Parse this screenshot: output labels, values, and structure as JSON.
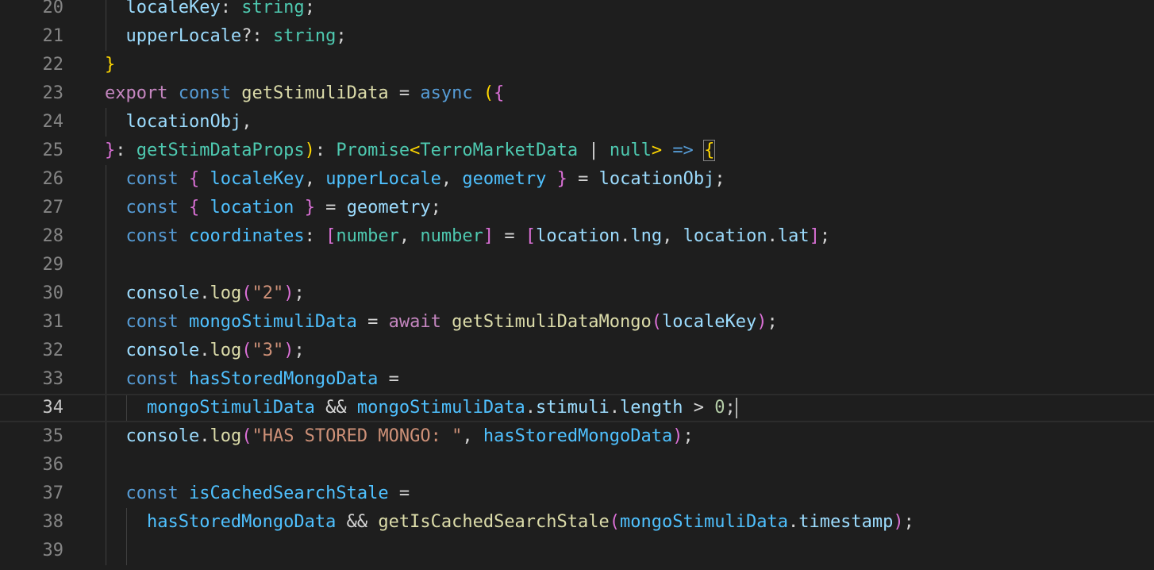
{
  "editor": {
    "cursor_line": "34",
    "colors": {
      "background": "#1e1e1e",
      "keyword": "#569cd6",
      "control": "#c586c0",
      "function": "#dcdcaa",
      "type": "#4ec9b0",
      "variable": "#9cdcfe",
      "constant": "#4fc1ff",
      "string": "#ce9178",
      "number": "#b5cea8",
      "bracket1": "#ffd700",
      "bracket2": "#da70d6",
      "bracket3": "#179fff"
    },
    "lines": [
      {
        "number": "20",
        "tokens": [
          {
            "c": "t-var",
            "t": "localeKey"
          },
          {
            "c": "t-plain",
            "t": ": "
          },
          {
            "c": "t-type",
            "t": "string"
          },
          {
            "c": "t-plain",
            "t": ";"
          }
        ]
      },
      {
        "number": "21",
        "tokens": [
          {
            "c": "t-var",
            "t": "upperLocale"
          },
          {
            "c": "t-plain",
            "t": "?: "
          },
          {
            "c": "t-type",
            "t": "string"
          },
          {
            "c": "t-plain",
            "t": ";"
          }
        ]
      },
      {
        "number": "22",
        "tokens": [
          {
            "c": "t-b1",
            "t": "}"
          }
        ]
      },
      {
        "number": "23",
        "tokens": [
          {
            "c": "t-flow",
            "t": "export"
          },
          {
            "c": "t-plain",
            "t": " "
          },
          {
            "c": "t-kw",
            "t": "const"
          },
          {
            "c": "t-plain",
            "t": " "
          },
          {
            "c": "t-fn",
            "t": "getStimuliData"
          },
          {
            "c": "t-plain",
            "t": " = "
          },
          {
            "c": "t-kw",
            "t": "async"
          },
          {
            "c": "t-plain",
            "t": " "
          },
          {
            "c": "t-b1",
            "t": "("
          },
          {
            "c": "t-b2",
            "t": "{"
          }
        ]
      },
      {
        "number": "24",
        "tokens": [
          {
            "c": "t-var",
            "t": "locationObj"
          },
          {
            "c": "t-plain",
            "t": ","
          }
        ]
      },
      {
        "number": "25",
        "tokens": [
          {
            "c": "t-b2",
            "t": "}"
          },
          {
            "c": "t-plain",
            "t": ": "
          },
          {
            "c": "t-type",
            "t": "getStimDataProps"
          },
          {
            "c": "t-b1",
            "t": ")"
          },
          {
            "c": "t-plain",
            "t": ": "
          },
          {
            "c": "t-type",
            "t": "Promise"
          },
          {
            "c": "t-b1",
            "t": "<"
          },
          {
            "c": "t-type",
            "t": "TerroMarketData"
          },
          {
            "c": "t-plain",
            "t": " | "
          },
          {
            "c": "t-type",
            "t": "null"
          },
          {
            "c": "t-b1",
            "t": ">"
          },
          {
            "c": "t-plain",
            "t": " "
          },
          {
            "c": "t-kw",
            "t": "=>"
          },
          {
            "c": "t-plain",
            "t": " "
          },
          {
            "c": "t-b1 bracket-box",
            "t": "{"
          }
        ]
      },
      {
        "number": "26",
        "tokens": [
          {
            "c": "t-kw",
            "t": "const"
          },
          {
            "c": "t-plain",
            "t": " "
          },
          {
            "c": "t-b2",
            "t": "{"
          },
          {
            "c": "t-plain",
            "t": " "
          },
          {
            "c": "t-const",
            "t": "localeKey"
          },
          {
            "c": "t-plain",
            "t": ", "
          },
          {
            "c": "t-const",
            "t": "upperLocale"
          },
          {
            "c": "t-plain",
            "t": ", "
          },
          {
            "c": "t-const",
            "t": "geometry"
          },
          {
            "c": "t-plain",
            "t": " "
          },
          {
            "c": "t-b2",
            "t": "}"
          },
          {
            "c": "t-plain",
            "t": " = "
          },
          {
            "c": "t-var",
            "t": "locationObj"
          },
          {
            "c": "t-plain",
            "t": ";"
          }
        ]
      },
      {
        "number": "27",
        "tokens": [
          {
            "c": "t-kw",
            "t": "const"
          },
          {
            "c": "t-plain",
            "t": " "
          },
          {
            "c": "t-b2",
            "t": "{"
          },
          {
            "c": "t-plain",
            "t": " "
          },
          {
            "c": "t-const",
            "t": "location"
          },
          {
            "c": "t-plain",
            "t": " "
          },
          {
            "c": "t-b2",
            "t": "}"
          },
          {
            "c": "t-plain",
            "t": " = "
          },
          {
            "c": "t-var",
            "t": "geometry"
          },
          {
            "c": "t-plain",
            "t": ";"
          }
        ]
      },
      {
        "number": "28",
        "tokens": [
          {
            "c": "t-kw",
            "t": "const"
          },
          {
            "c": "t-plain",
            "t": " "
          },
          {
            "c": "t-const",
            "t": "coordinates"
          },
          {
            "c": "t-plain",
            "t": ": "
          },
          {
            "c": "t-b2",
            "t": "["
          },
          {
            "c": "t-type",
            "t": "number"
          },
          {
            "c": "t-plain",
            "t": ", "
          },
          {
            "c": "t-type",
            "t": "number"
          },
          {
            "c": "t-b2",
            "t": "]"
          },
          {
            "c": "t-plain",
            "t": " = "
          },
          {
            "c": "t-b2",
            "t": "["
          },
          {
            "c": "t-var",
            "t": "location"
          },
          {
            "c": "t-plain",
            "t": "."
          },
          {
            "c": "t-var",
            "t": "lng"
          },
          {
            "c": "t-plain",
            "t": ", "
          },
          {
            "c": "t-var",
            "t": "location"
          },
          {
            "c": "t-plain",
            "t": "."
          },
          {
            "c": "t-var",
            "t": "lat"
          },
          {
            "c": "t-b2",
            "t": "]"
          },
          {
            "c": "t-plain",
            "t": ";"
          }
        ]
      },
      {
        "number": "29",
        "tokens": []
      },
      {
        "number": "30",
        "tokens": [
          {
            "c": "t-var",
            "t": "console"
          },
          {
            "c": "t-plain",
            "t": "."
          },
          {
            "c": "t-fn",
            "t": "log"
          },
          {
            "c": "t-b2",
            "t": "("
          },
          {
            "c": "t-str",
            "t": "\"2\""
          },
          {
            "c": "t-b2",
            "t": ")"
          },
          {
            "c": "t-plain",
            "t": ";"
          }
        ]
      },
      {
        "number": "31",
        "tokens": [
          {
            "c": "t-kw",
            "t": "const"
          },
          {
            "c": "t-plain",
            "t": " "
          },
          {
            "c": "t-const",
            "t": "mongoStimuliData"
          },
          {
            "c": "t-plain",
            "t": " = "
          },
          {
            "c": "t-flow",
            "t": "await"
          },
          {
            "c": "t-plain",
            "t": " "
          },
          {
            "c": "t-fn",
            "t": "getStimuliDataMongo"
          },
          {
            "c": "t-b2",
            "t": "("
          },
          {
            "c": "t-var",
            "t": "localeKey"
          },
          {
            "c": "t-b2",
            "t": ")"
          },
          {
            "c": "t-plain",
            "t": ";"
          }
        ]
      },
      {
        "number": "32",
        "tokens": [
          {
            "c": "t-var",
            "t": "console"
          },
          {
            "c": "t-plain",
            "t": "."
          },
          {
            "c": "t-fn",
            "t": "log"
          },
          {
            "c": "t-b2",
            "t": "("
          },
          {
            "c": "t-str",
            "t": "\"3\""
          },
          {
            "c": "t-b2",
            "t": ")"
          },
          {
            "c": "t-plain",
            "t": ";"
          }
        ]
      },
      {
        "number": "33",
        "tokens": [
          {
            "c": "t-kw",
            "t": "const"
          },
          {
            "c": "t-plain",
            "t": " "
          },
          {
            "c": "t-const",
            "t": "hasStoredMongoData"
          },
          {
            "c": "t-plain",
            "t": " ="
          }
        ]
      },
      {
        "number": "34",
        "tokens": [
          {
            "c": "t-const",
            "t": "mongoStimuliData"
          },
          {
            "c": "t-plain",
            "t": " && "
          },
          {
            "c": "t-const",
            "t": "mongoStimuliData"
          },
          {
            "c": "t-plain",
            "t": "."
          },
          {
            "c": "t-var",
            "t": "stimuli"
          },
          {
            "c": "t-plain",
            "t": "."
          },
          {
            "c": "t-var",
            "t": "length"
          },
          {
            "c": "t-plain",
            "t": " > "
          },
          {
            "c": "t-num",
            "t": "0"
          },
          {
            "c": "t-plain",
            "t": ";"
          }
        ]
      },
      {
        "number": "35",
        "tokens": [
          {
            "c": "t-var",
            "t": "console"
          },
          {
            "c": "t-plain",
            "t": "."
          },
          {
            "c": "t-fn",
            "t": "log"
          },
          {
            "c": "t-b2",
            "t": "("
          },
          {
            "c": "t-str",
            "t": "\"HAS STORED MONGO: \""
          },
          {
            "c": "t-plain",
            "t": ", "
          },
          {
            "c": "t-const",
            "t": "hasStoredMongoData"
          },
          {
            "c": "t-b2",
            "t": ")"
          },
          {
            "c": "t-plain",
            "t": ";"
          }
        ]
      },
      {
        "number": "36",
        "tokens": []
      },
      {
        "number": "37",
        "tokens": [
          {
            "c": "t-kw",
            "t": "const"
          },
          {
            "c": "t-plain",
            "t": " "
          },
          {
            "c": "t-const",
            "t": "isCachedSearchStale"
          },
          {
            "c": "t-plain",
            "t": " ="
          }
        ]
      },
      {
        "number": "38",
        "tokens": [
          {
            "c": "t-const",
            "t": "hasStoredMongoData"
          },
          {
            "c": "t-plain",
            "t": " && "
          },
          {
            "c": "t-fn",
            "t": "getIsCachedSearchStale"
          },
          {
            "c": "t-b2",
            "t": "("
          },
          {
            "c": "t-const",
            "t": "mongoStimuliData"
          },
          {
            "c": "t-plain",
            "t": "."
          },
          {
            "c": "t-var",
            "t": "timestamp"
          },
          {
            "c": "t-b2",
            "t": ")"
          },
          {
            "c": "t-plain",
            "t": ";"
          }
        ]
      },
      {
        "number": "39",
        "tokens": []
      }
    ]
  }
}
